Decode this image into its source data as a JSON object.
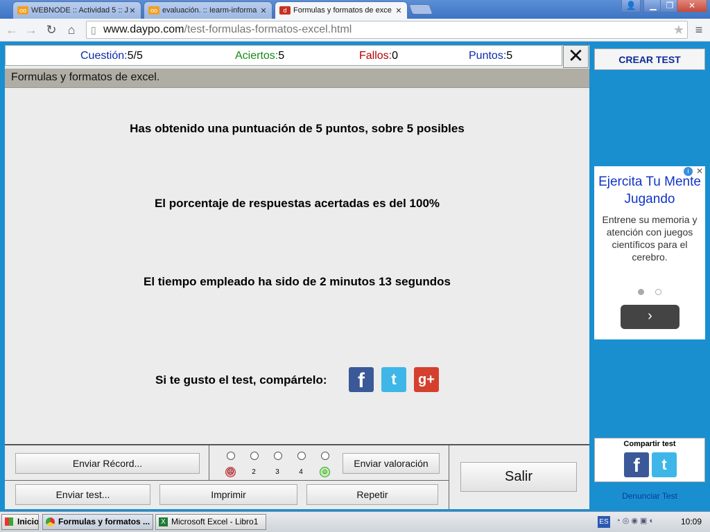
{
  "browser": {
    "tabs": [
      {
        "label": "WEBNODE :: Actividad 5 :: Jl",
        "icon": "webnode-icon"
      },
      {
        "label": "evaluación. :: Iearm-informa",
        "icon": "webnode-icon"
      },
      {
        "label": "Formulas y formatos de exce",
        "icon": "daypo-icon"
      }
    ],
    "url_host": "www.daypo.com",
    "url_path": "/test-formulas-formatos-excel.html"
  },
  "status": {
    "question_label": "Cuestión:",
    "question_value": "5/5",
    "correct_label": "Aciertos:",
    "correct_value": "5",
    "wrong_label": "Fallos:",
    "wrong_value": "0",
    "points_label": "Puntos:",
    "points_value": "5",
    "colors": {
      "question": "#0b2aa8",
      "correct": "#138a13",
      "wrong": "#b30000",
      "points": "#0b2aa8"
    }
  },
  "test": {
    "title": "Formulas y formatos de excel.",
    "score_text": "Has obtenido una puntuación de 5 puntos, sobre 5 posibles",
    "percent_text": "El porcentaje de respuestas acertadas es del 100%",
    "time_text": "El tiempo empleado ha sido de 2 minutos 13 segundos",
    "share_text": "Si te gusto el test, compártelo:"
  },
  "social": {
    "facebook": "f",
    "twitter": "t",
    "google": "g+"
  },
  "actions": {
    "send_record": "Enviar Récord...",
    "send_rating": "Enviar valoración",
    "send_test": "Enviar test...",
    "print": "Imprimir",
    "repeat": "Repetir",
    "exit": "Salir"
  },
  "rating": {
    "labels": [
      "",
      "2",
      "3",
      "4",
      ""
    ],
    "selected": null
  },
  "sidebar": {
    "create_test": "CREAR TEST",
    "ad_title": "Ejercita Tu Mente Jugando",
    "ad_body": "Entrene su memoria y atención con juegos científicos para el cerebro.",
    "share_title": "Compartir test",
    "report": "Denunciar Test"
  },
  "taskbar": {
    "start": "Inicio",
    "tasks": [
      "Formulas y formatos ...",
      "Microsoft Excel - Libro1"
    ],
    "lang": "ES",
    "clock": "10:09"
  }
}
